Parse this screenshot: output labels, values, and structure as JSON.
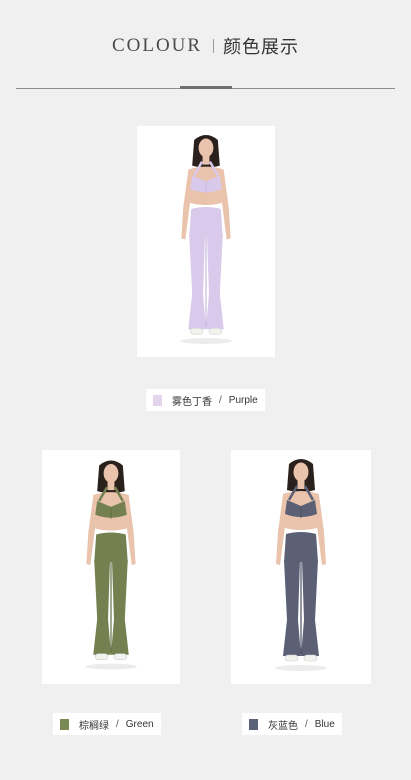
{
  "header": {
    "title_en": "COLOUR",
    "title_cn": "颜色展示"
  },
  "colors": [
    {
      "name_cn": "雾色丁香",
      "name_en": "Purple",
      "separator": "/",
      "swatch": "#e4d4ec",
      "garment": "#d9c9ea",
      "garment_shade": "#c8b6dd",
      "icon": "model-purple-photo"
    },
    {
      "name_cn": "棕榈绿",
      "name_en": "Green",
      "separator": "/",
      "swatch": "#7a8a55",
      "garment": "#74804f",
      "garment_shade": "#636e42",
      "icon": "model-green-photo"
    },
    {
      "name_cn": "灰蓝色",
      "name_en": "Blue",
      "separator": "/",
      "swatch": "#5a6178",
      "garment": "#5b6075",
      "garment_shade": "#4c5165",
      "icon": "model-blue-photo"
    }
  ],
  "skin": "#e9c3ab",
  "hair": "#2a201c"
}
